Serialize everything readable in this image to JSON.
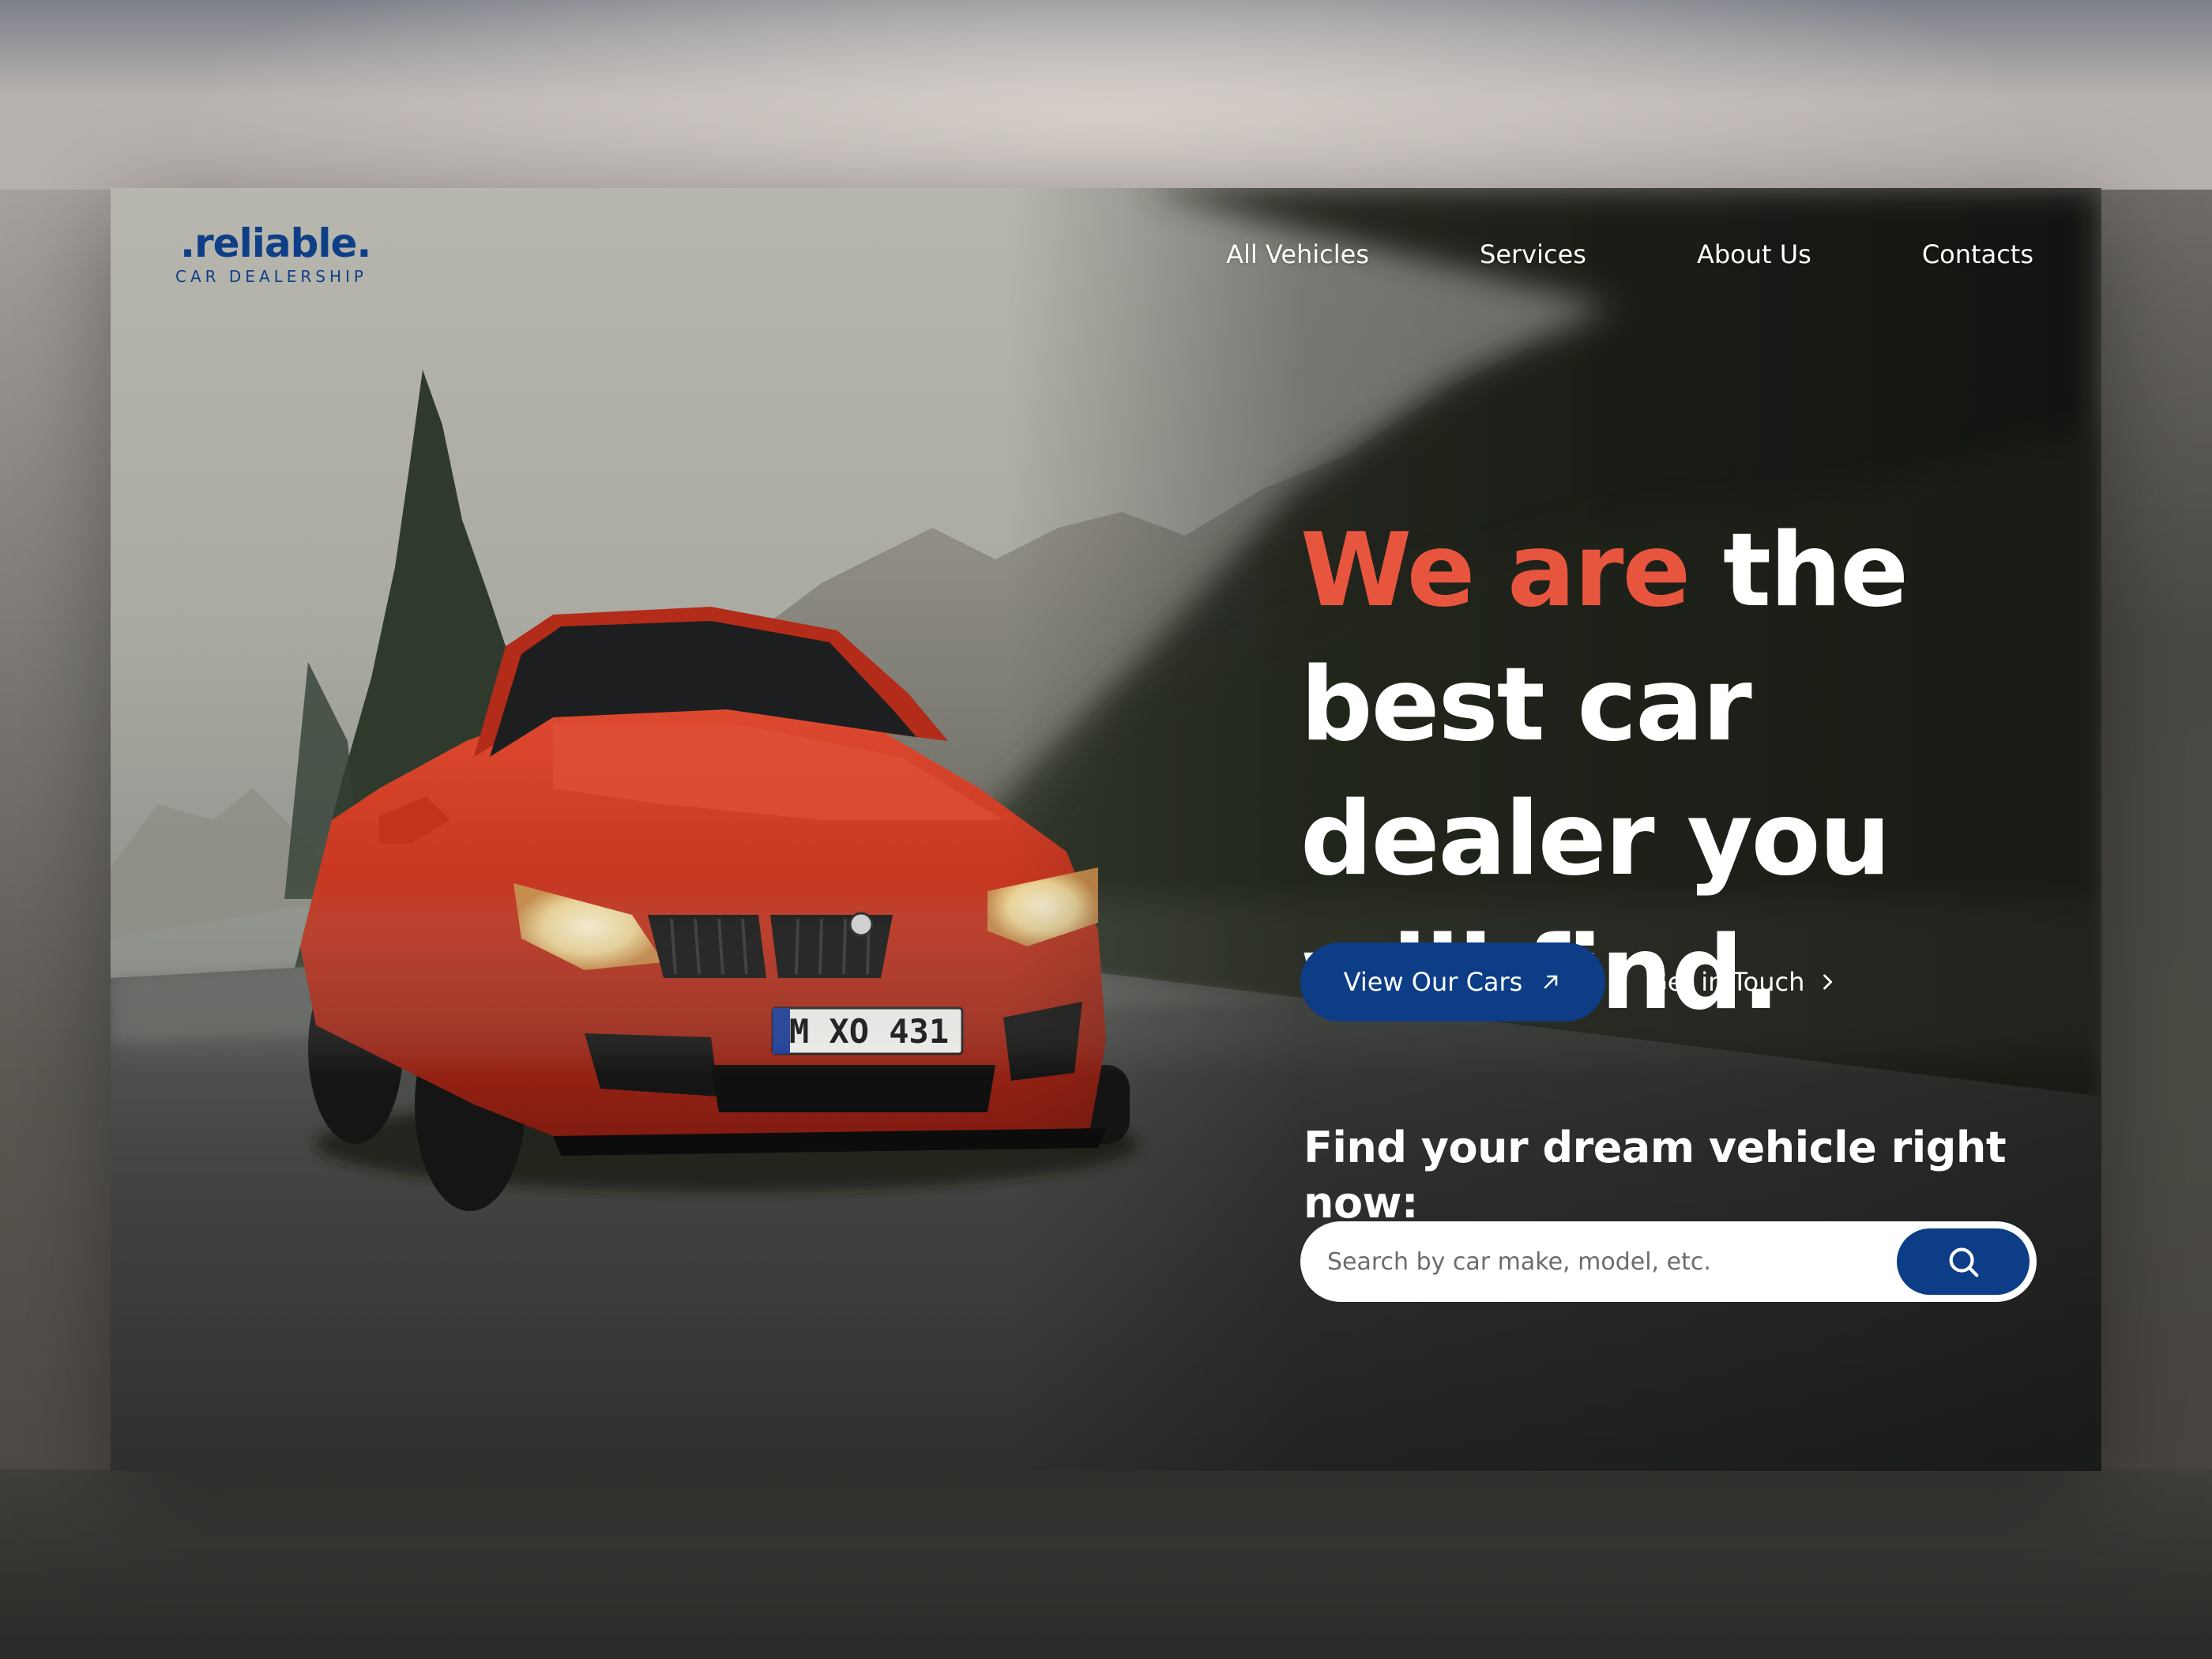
{
  "logo": {
    "name": ".reliable.",
    "tagline": "CAR DEALERSHIP"
  },
  "nav": {
    "items": [
      "All Vehicles",
      "Services",
      "About Us",
      "Contacts"
    ]
  },
  "hero": {
    "headline_accent": "We are",
    "headline_rest": " the best car dealer you will find.",
    "primary_button": "View Our Cars",
    "secondary_button": "Get in Touch",
    "license_plate": "M XO 431"
  },
  "search": {
    "title": "Find your dream vehicle right now:",
    "placeholder": "Search by car make, model, etc."
  },
  "colors": {
    "brand_blue": "#0c3d86",
    "accent_orange": "#e8553e",
    "car_red": "#c8321f"
  },
  "icons": {
    "primary_button_icon": "arrow-up-right-icon",
    "secondary_button_icon": "chevron-right-icon",
    "search_button_icon": "search-icon"
  }
}
